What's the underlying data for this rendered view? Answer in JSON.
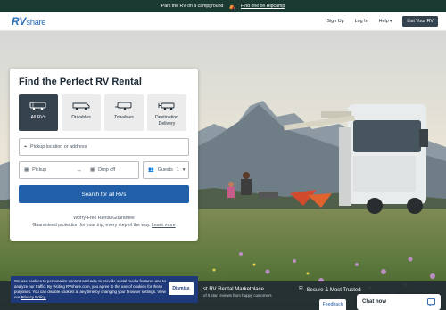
{
  "promo": {
    "text": "Park the RV on a campground",
    "link": "Find one on Hipcamp"
  },
  "header": {
    "logo_rv": "RV",
    "logo_share": "share",
    "nav": [
      "Sign Up",
      "Log In",
      "Help"
    ],
    "list_button": "List Your RV"
  },
  "search": {
    "title": "Find the Perfect RV Rental",
    "types": [
      {
        "label": "All RVs",
        "icon": "rv-icon"
      },
      {
        "label": "Drivables",
        "icon": "motorhome-icon"
      },
      {
        "label": "Towables",
        "icon": "trailer-icon"
      },
      {
        "label": "Destination Delivery",
        "icon": "delivery-icon"
      }
    ],
    "location_placeholder": "Pickup location or address",
    "pickup": "Pickup",
    "dropoff": "Drop off",
    "guests": "Guests",
    "guests_count": "1",
    "button": "Search for all RVs",
    "guarantee_title": "Worry-Free Rental Guarantee",
    "guarantee_text": "Guaranteed protection for your trip, every step of the way.",
    "learn_more": "Learn more"
  },
  "strip": {
    "marketplace": "st RV Rental Marketplace",
    "marketplace_sub": "of 5 star reviews from happy customers",
    "secure": "Secure & Most Trusted"
  },
  "cookie": {
    "text": "We use cookies to personalize content and ads, to provide social media features and to analyze our traffic. By visiting RVshare.com, you agree to the use of cookies for these purposes. You can disable cookies at any time by changing your browser settings. View our ",
    "link": "Privacy Policy.",
    "dismiss": "Dismiss"
  },
  "feedback": "Feedback",
  "chat": "Chat now",
  "colors": {
    "brand": "#2b6fb6",
    "primary_button": "#2160a8",
    "dark": "#35434f",
    "promo_bg": "#1a3a32",
    "cookie_bg": "#1f3a7a"
  }
}
